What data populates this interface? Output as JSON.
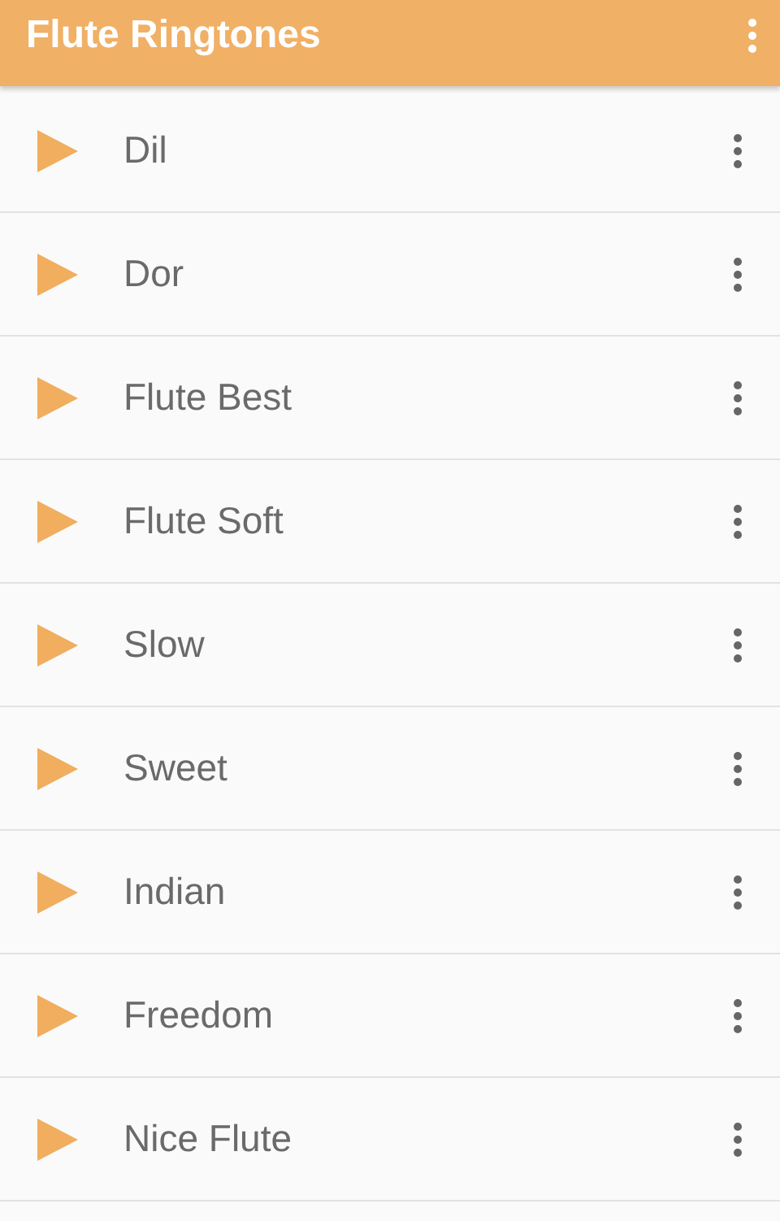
{
  "app_bar": {
    "title": "Flute Ringtones"
  },
  "ringtones": [
    {
      "name": "Dil"
    },
    {
      "name": "Dor"
    },
    {
      "name": "Flute Best"
    },
    {
      "name": "Flute Soft"
    },
    {
      "name": "Slow"
    },
    {
      "name": "Sweet"
    },
    {
      "name": "Indian"
    },
    {
      "name": "Freedom"
    },
    {
      "name": "Nice Flute"
    }
  ]
}
